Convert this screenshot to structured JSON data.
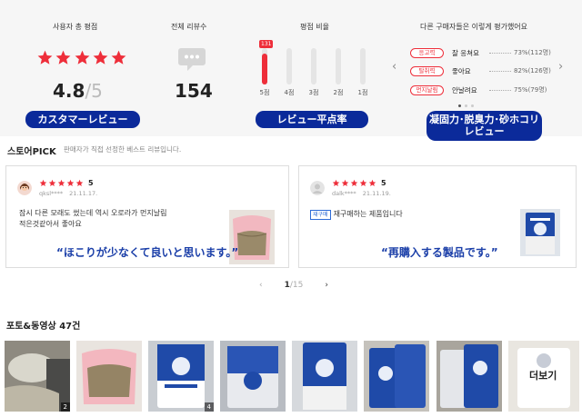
{
  "summary": {
    "user_rating_title": "사용자 총 평점",
    "total_reviews_title": "전체 리뷰수",
    "rating_ratio_title": "평점 비율",
    "buyer_eval_title": "다른 구매자들은 이렇게 평가했어요",
    "average": "4.8",
    "average_max": "/5",
    "total_reviews": "154",
    "star_color": "#ee2e3a",
    "ratio": {
      "top_count_badge": "131",
      "bars": [
        {
          "label": "5점",
          "fraction": 0.85
        },
        {
          "label": "4점",
          "fraction": 0.0
        },
        {
          "label": "3점",
          "fraction": 0.0
        },
        {
          "label": "2점",
          "fraction": 0.0
        },
        {
          "label": "1점",
          "fraction": 0.0
        }
      ]
    },
    "evaluations": [
      {
        "chip": "응고력",
        "text": "잘 응쳐요",
        "pct": "73%",
        "count": "(112명)"
      },
      {
        "chip": "탈취력",
        "text": "좋아요",
        "pct": "82%",
        "count": "(126명)"
      },
      {
        "chip": "먼지날림",
        "text": "안날려요",
        "pct": "75%",
        "count": "(79명)"
      }
    ],
    "arrows": {
      "prev": "‹",
      "next": "›"
    }
  },
  "pills": {
    "customer_review": "カスタマーレビュー",
    "review_score": "レビュー平点率",
    "attributes_line1": "凝固力･脱臭力･砂ホコリ",
    "attributes_line2": "レビュー"
  },
  "store_pick": {
    "title": "스토어PICK",
    "subtitle": "판매자가 직접 선정한 베스트 리뷰입니다.",
    "reviews": [
      {
        "score": "5",
        "user": "qksl****",
        "date": "21.11.17.",
        "text_line1": "잠시 다른 모래도 썼는데 역시 오로라가 먼지날림",
        "text_line2": "적은것같아서 좋아요",
        "quote": "“ほこりが少なくて良いと思います。”"
      },
      {
        "score": "5",
        "user": "dalk****",
        "date": "21.11.19.",
        "badge": "재구매",
        "text_line1": "재구매하는 제품입니다",
        "quote": "“再購入する製品です。”"
      }
    ],
    "pagination": {
      "current": "1",
      "separator": "/",
      "total": "15",
      "prev": "‹",
      "next": "›"
    }
  },
  "photos": {
    "title_prefix": "포토&동영상",
    "title_count": "47건",
    "thumb_counts": [
      "2",
      "4"
    ],
    "more_label": "더보기"
  }
}
